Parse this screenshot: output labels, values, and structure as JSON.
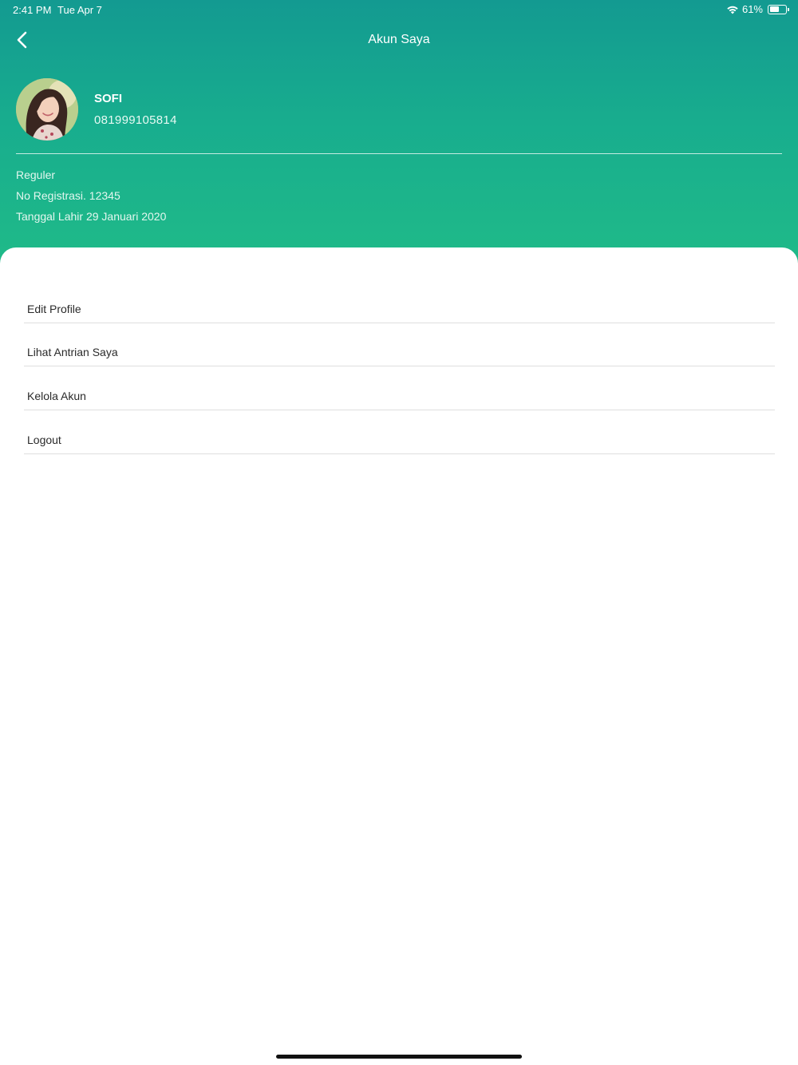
{
  "status_bar": {
    "time": "2:41 PM",
    "date": "Tue Apr 7",
    "battery_label": "61%",
    "battery_level": 0.61,
    "icons": [
      "wifi-icon",
      "battery-icon"
    ]
  },
  "nav": {
    "title": "Akun Saya",
    "back_icon": "chevron-left-icon"
  },
  "profile": {
    "name": "SOFI",
    "phone": "081999105814",
    "avatar_icon": "user-avatar-photo",
    "member_type": "Reguler",
    "registration": "No Registrasi. 12345",
    "birth_date": "Tanggal Lahir 29 Januari 2020"
  },
  "menu": {
    "items": [
      {
        "label": "Edit Profile"
      },
      {
        "label": "Lihat Antrian Saya"
      },
      {
        "label": "Kelola Akun"
      },
      {
        "label": "Logout"
      }
    ]
  },
  "colors": {
    "header_gradient_top": "#139a91",
    "header_gradient_bottom": "#20bb88",
    "menu_text": "#2a2a2a",
    "divider": "#dedede"
  }
}
